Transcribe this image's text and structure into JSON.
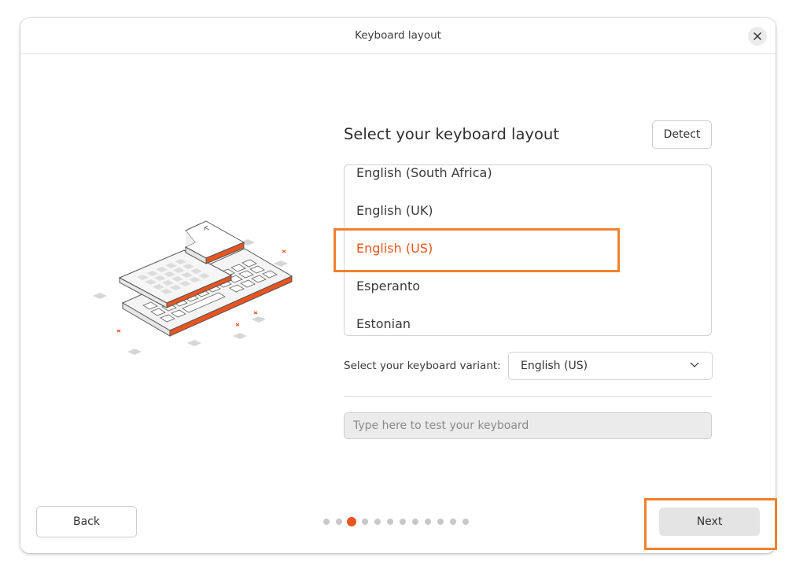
{
  "window": {
    "title": "Keyboard layout"
  },
  "main": {
    "heading": "Select your keyboard layout",
    "detect_label": "Detect",
    "layouts": [
      "English (South Africa)",
      "English (UK)",
      "English (US)",
      "Esperanto",
      "Estonian"
    ],
    "selected_layout": "English (US)",
    "variant_label": "Select your keyboard variant:",
    "variant_value": "English (US)",
    "test_placeholder": "Type here to test your keyboard"
  },
  "footer": {
    "back_label": "Back",
    "next_label": "Next",
    "page_count": 12,
    "current_page": 3
  },
  "colors": {
    "accent": "#e95420",
    "highlight": "#f08030"
  }
}
